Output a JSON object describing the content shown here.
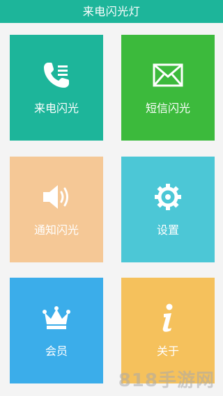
{
  "app": {
    "title": "来电闪光灯",
    "header_color": "#1db59a"
  },
  "tiles": [
    {
      "label": "来电闪光",
      "icon": "phone-list-icon",
      "color": "#1db59a"
    },
    {
      "label": "短信闪光",
      "icon": "envelope-icon",
      "color": "#3cba3c"
    },
    {
      "label": "通知闪光",
      "icon": "speaker-icon",
      "color": "#f5c896"
    },
    {
      "label": "设置",
      "icon": "gear-icon",
      "color": "#4cc7d6"
    },
    {
      "label": "会员",
      "icon": "crown-icon",
      "color": "#3badea"
    },
    {
      "label": "关于",
      "icon": "info-icon",
      "color": "#f5c15c"
    }
  ],
  "watermark": "818手游网"
}
